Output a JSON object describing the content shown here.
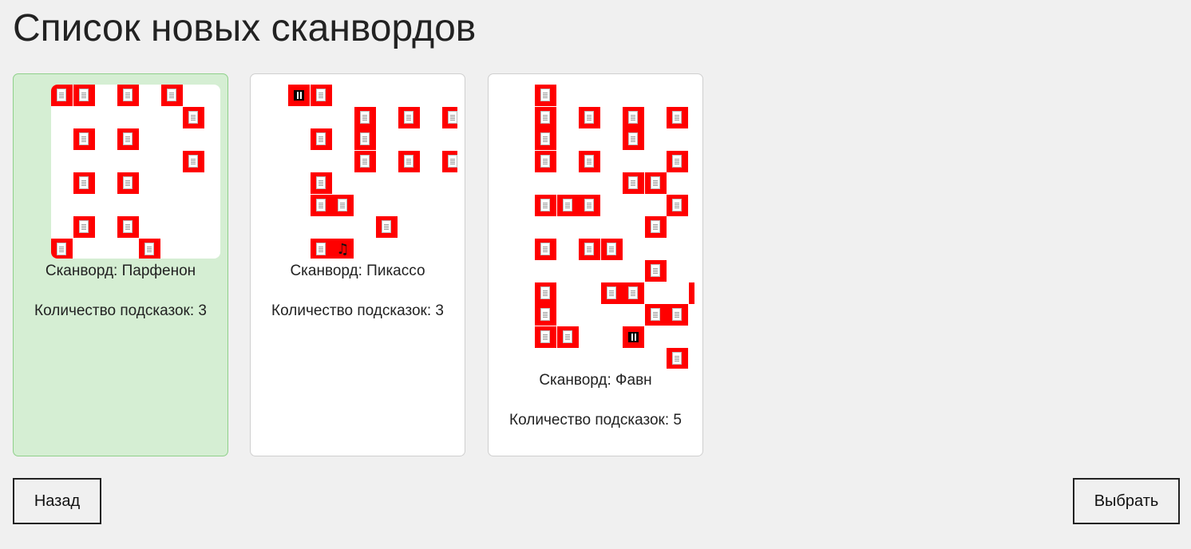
{
  "page": {
    "title": "Список новых сканвордов"
  },
  "cards": [
    {
      "name_label": "Сканворд: Парфенон",
      "hints_label": "Количество подсказок: 3",
      "selected": true
    },
    {
      "name_label": "Сканворд: Пикассо",
      "hints_label": "Количество подсказок: 3",
      "selected": false
    },
    {
      "name_label": "Сканворд: Фавн",
      "hints_label": "Количество подсказок: 5",
      "selected": false
    }
  ],
  "buttons": {
    "back": "Назад",
    "select": "Выбрать"
  },
  "colors": {
    "cell": "#ff0000",
    "selected_bg": "#d5eed3",
    "selected_border": "#8fd08a"
  }
}
